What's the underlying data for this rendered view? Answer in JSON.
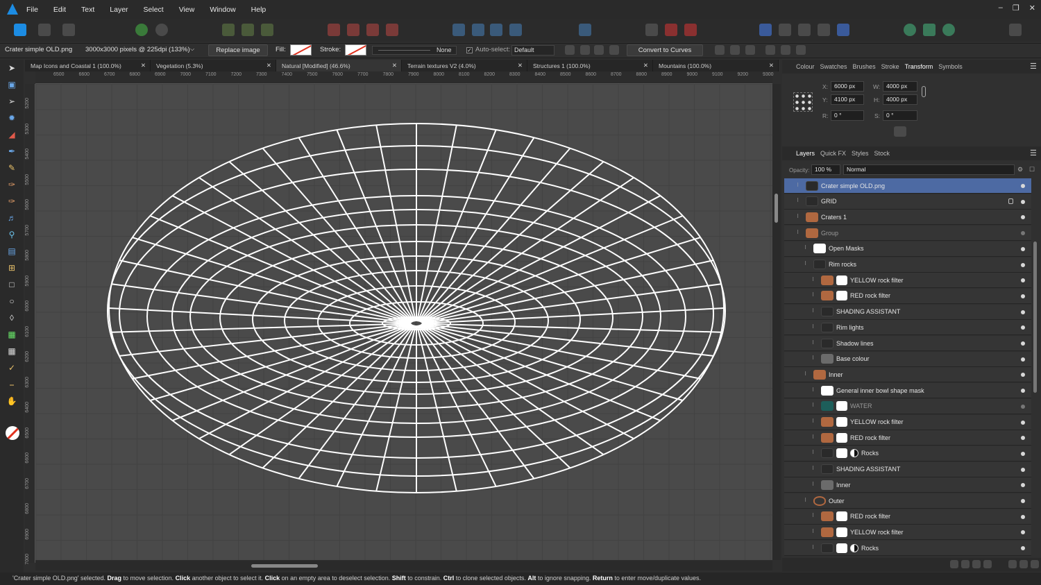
{
  "menubar": {
    "items": [
      "File",
      "Edit",
      "Text",
      "Layer",
      "Select",
      "View",
      "Window",
      "Help"
    ]
  },
  "context": {
    "doc_name": "Crater simple OLD.png",
    "doc_info": "3000x3000 pixels @ 225dpi (133%)",
    "replace_image": "Replace image",
    "fill_label": "Fill:",
    "stroke_label": "Stroke:",
    "stroke_style": "None",
    "auto_select_label": "Auto-select:",
    "auto_select_value": "Default",
    "convert_to_curves": "Convert to Curves"
  },
  "tabs": [
    {
      "label": "Map Icons and Coastal 1 (100.0%)"
    },
    {
      "label": "Vegetation (5.3%)"
    },
    {
      "label": "Natural [Modified] (46.6%)"
    },
    {
      "label": "Terrain textures V2 (4.0%)"
    },
    {
      "label": "Structures 1 (100.0%)"
    },
    {
      "label": "Mountains (100.0%)"
    }
  ],
  "ruler_top_labels": [
    "6500",
    "6600",
    "6700",
    "6800",
    "6900",
    "7000",
    "7100",
    "7200",
    "7300",
    "7400",
    "7500",
    "7600",
    "7700",
    "7800",
    "7900",
    "8000",
    "8100",
    "8200",
    "8300",
    "8400",
    "8500",
    "8600",
    "8700",
    "8800",
    "8900",
    "9000",
    "9100",
    "9200",
    "9300",
    "9400"
  ],
  "ruler_left_labels": [
    "5200",
    "5300",
    "5400",
    "5500",
    "5600",
    "5700",
    "5800",
    "5900",
    "6000",
    "6100",
    "6200",
    "6300",
    "6400",
    "6500",
    "6600",
    "6700",
    "6800",
    "6900",
    "7000"
  ],
  "studio_top": {
    "tabs": [
      "Colour",
      "Swatches",
      "Brushes",
      "Stroke",
      "Transform",
      "Symbols"
    ],
    "active": "Transform"
  },
  "transform": {
    "x_label": "X:",
    "x": "6000 px",
    "y_label": "Y:",
    "y": "4100 px",
    "w_label": "W:",
    "w": "4000 px",
    "h_label": "H:",
    "h": "4000 px",
    "r_label": "R:",
    "r": "0 °",
    "s_label": "S:",
    "s": "0 °"
  },
  "studio_bottom": {
    "tabs": [
      "Layers",
      "Quick FX",
      "Styles",
      "Stock"
    ],
    "active": "Layers"
  },
  "layers_panel": {
    "opacity_label": "Opacity:",
    "opacity": "100 %",
    "blend_mode": "Normal",
    "layers": [
      {
        "name": "Crater simple OLD.png",
        "indent": 0,
        "thumb": "dark",
        "selected": true
      },
      {
        "name": "GRID",
        "indent": 0,
        "thumb": "dark",
        "locked": true
      },
      {
        "name": "Craters 1",
        "indent": 0,
        "thumb": "rock"
      },
      {
        "name": "Group",
        "indent": 0,
        "thumb": "rock",
        "dim": true
      },
      {
        "name": "Open Masks",
        "indent": 1,
        "thumb": "white"
      },
      {
        "name": "Rim rocks",
        "indent": 1,
        "thumb": "dark"
      },
      {
        "name": "YELLOW rock filter",
        "indent": 2,
        "thumb": "rock",
        "mask": true
      },
      {
        "name": "RED rock filter",
        "indent": 2,
        "thumb": "rock",
        "mask": true
      },
      {
        "name": "SHADING ASSISTANT",
        "indent": 2,
        "thumb": "dark"
      },
      {
        "name": "Rim lights",
        "indent": 2,
        "thumb": "dark"
      },
      {
        "name": "Shadow lines",
        "indent": 2,
        "thumb": "dark"
      },
      {
        "name": "Base colour",
        "indent": 2,
        "thumb": "grey"
      },
      {
        "name": "Inner",
        "indent": 1,
        "thumb": "rock"
      },
      {
        "name": "General inner bowl shape mask",
        "indent": 2,
        "thumb": "white"
      },
      {
        "name": "WATER",
        "indent": 2,
        "thumb": "teal",
        "mask": true,
        "dim": true
      },
      {
        "name": "YELLOW rock filter",
        "indent": 2,
        "thumb": "rock",
        "mask": true
      },
      {
        "name": "RED rock filter",
        "indent": 2,
        "thumb": "rock",
        "mask": true
      },
      {
        "name": "Rocks",
        "indent": 2,
        "thumb": "dark",
        "mask": true,
        "adjust": true
      },
      {
        "name": "SHADING ASSISTANT",
        "indent": 2,
        "thumb": "dark"
      },
      {
        "name": "Inner",
        "indent": 2,
        "thumb": "grey"
      },
      {
        "name": "Outer",
        "indent": 1,
        "thumb": "outer"
      },
      {
        "name": "RED rock filter",
        "indent": 2,
        "thumb": "rock",
        "mask": true
      },
      {
        "name": "YELLOW rock filter",
        "indent": 2,
        "thumb": "rock",
        "mask": true
      },
      {
        "name": "Rocks",
        "indent": 2,
        "thumb": "dark",
        "mask": true,
        "adjust": true
      }
    ]
  },
  "status": {
    "quote": "'Crater simple OLD.png' selected. ",
    "k1": "Drag",
    "t1": " to move selection. ",
    "k2": "Click",
    "t2": " another object to select it. ",
    "k3": "Click",
    "t3": " on an empty area to deselect selection. ",
    "k4": "Shift",
    "t4": " to constrain. ",
    "k5": "Ctrl",
    "t5": " to clone selected objects. ",
    "k6": "Alt",
    "t6": " to ignore snapping. ",
    "k7": "Return",
    "t7": " to enter move/duplicate values."
  },
  "colors": {
    "accent": "#1c8ce3",
    "selection": "#4d6aa3",
    "canvas": "#4a4a4a",
    "wireframe": "#ffffff"
  }
}
